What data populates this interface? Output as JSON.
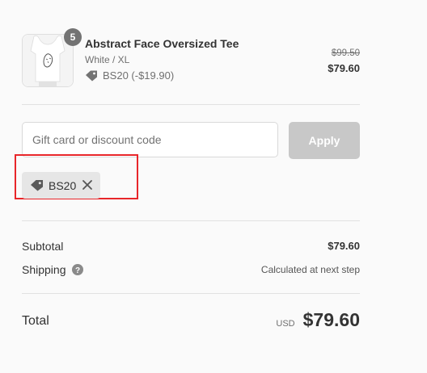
{
  "product": {
    "quantity": "5",
    "title": "Abstract Face Oversized Tee",
    "variant": "White / XL",
    "discount_line": "BS20 (-$19.90)",
    "original_price": "$99.50",
    "price": "$79.60",
    "image": "white-tshirt-abstract-face"
  },
  "discount_form": {
    "placeholder": "Gift card or discount code",
    "value": "",
    "apply_label": "Apply"
  },
  "applied_code": {
    "code": "BS20",
    "icon": "tag-icon",
    "remove_icon": "close-icon"
  },
  "summary": {
    "subtotal_label": "Subtotal",
    "subtotal_value": "$79.60",
    "shipping_label": "Shipping",
    "shipping_value": "Calculated at next step",
    "total_label": "Total",
    "currency": "USD",
    "total_value": "$79.60"
  },
  "colors": {
    "background": "#fafafa",
    "highlight": "#e8262a",
    "apply_button": "#c8c8c8",
    "quantity_badge": "#737373"
  }
}
